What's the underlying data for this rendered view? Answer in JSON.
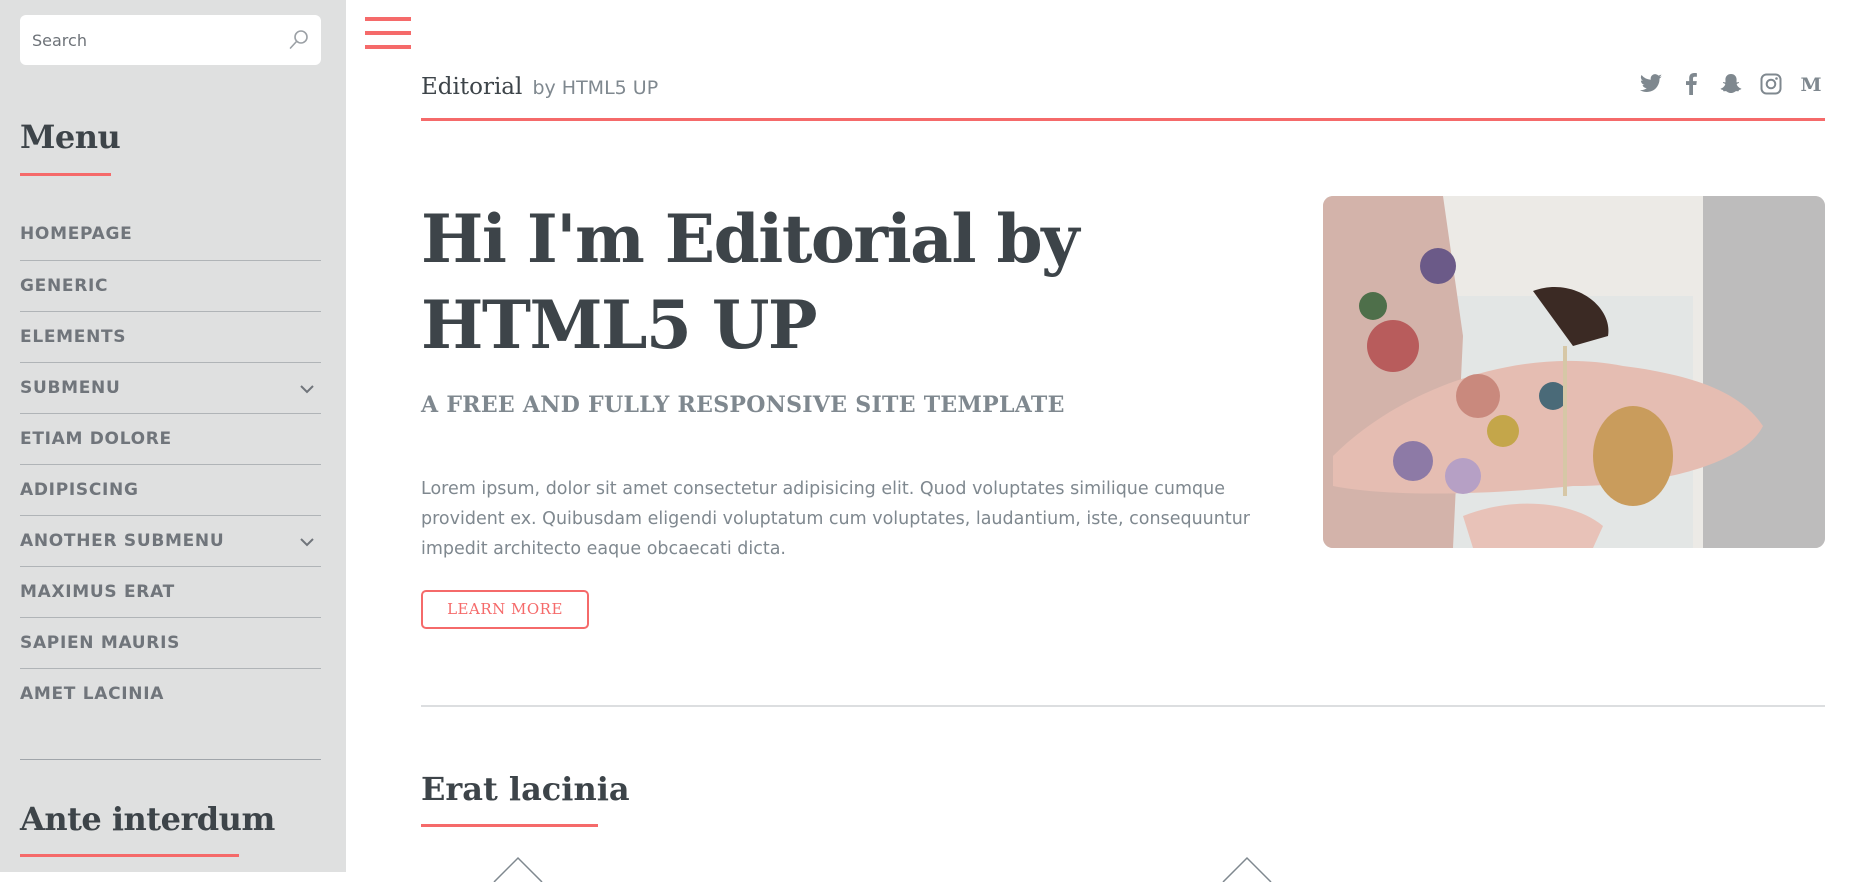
{
  "sidebar": {
    "search_placeholder": "Search",
    "menu_heading": "Menu",
    "items": [
      {
        "label": "Homepage"
      },
      {
        "label": "Generic"
      },
      {
        "label": "Elements"
      },
      {
        "label": "Submenu",
        "has_submenu": true
      },
      {
        "label": "Etiam Dolore"
      },
      {
        "label": "Adipiscing"
      },
      {
        "label": "Another Submenu",
        "has_submenu": true
      },
      {
        "label": "Maximus Erat"
      },
      {
        "label": "Sapien Mauris"
      },
      {
        "label": "Amet Lacinia"
      }
    ],
    "second_heading": "Ante interdum"
  },
  "header": {
    "logo_main": "Editorial",
    "logo_sub": "by HTML5 UP",
    "social_icons": [
      "twitter-icon",
      "facebook-icon",
      "snapchat-icon",
      "instagram-icon",
      "medium-icon"
    ]
  },
  "hero": {
    "title": "Hi I'm Editorial by HTML5 UP",
    "subtitle": "A free and fully responsive site template",
    "text": "Lorem ipsum, dolor sit amet consectetur adipisicing elit. Quod voluptates similique cumque provident ex. Quibusdam eligendi voluptatum cum voluptates, laudantium, iste, consequuntur impedit architecto eaque obcaecati dicta.",
    "button_label": "Learn More"
  },
  "section": {
    "title": "Erat lacinia"
  },
  "colors": {
    "accent": "#f56a6a",
    "text": "#3d4449",
    "muted": "#7f888f",
    "sidebar_bg": "#dfe0e0"
  }
}
